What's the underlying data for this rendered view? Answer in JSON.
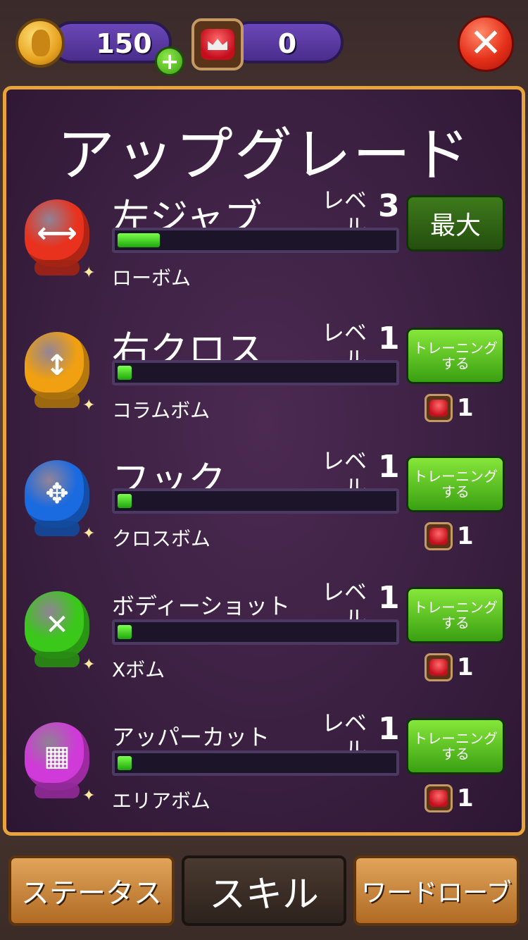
{
  "currency": {
    "coins": "150",
    "gems": "0"
  },
  "panel": {
    "title": "アップグレード"
  },
  "level_label": "レベル",
  "skills": [
    {
      "name": "左ジャブ",
      "level": "3",
      "bomb": "ローボム",
      "progress": 0.15,
      "button": "最大",
      "button_type": "max",
      "glove_color": "#e8321e",
      "glove_glyph": "⟷"
    },
    {
      "name": "右クロス",
      "level": "1",
      "bomb": "コラムボム",
      "progress": 0.05,
      "button": "トレーニングする",
      "button_type": "train",
      "cost": "1",
      "glove_color": "#f0a010",
      "glove_glyph": "↕"
    },
    {
      "name": "フック",
      "level": "1",
      "bomb": "クロスボム",
      "progress": 0.05,
      "button": "トレーニングする",
      "button_type": "train",
      "cost": "1",
      "glove_color": "#1a6ae0",
      "glove_glyph": "✥"
    },
    {
      "name": "ボディーショット",
      "level": "1",
      "bomb": "Xボム",
      "progress": 0.05,
      "button": "トレーニングする",
      "button_type": "train",
      "cost": "1",
      "glove_color": "#3ac81a",
      "glove_glyph": "✕"
    },
    {
      "name": "アッパーカット",
      "level": "1",
      "bomb": "エリアボム",
      "progress": 0.05,
      "button": "トレーニングする",
      "button_type": "train",
      "cost": "1",
      "glove_color": "#d03ad8",
      "glove_glyph": "▦"
    }
  ],
  "tabs": [
    {
      "label": "ステータス",
      "active": false
    },
    {
      "label": "スキル",
      "active": true
    },
    {
      "label": "ワードローブ",
      "active": false
    }
  ]
}
